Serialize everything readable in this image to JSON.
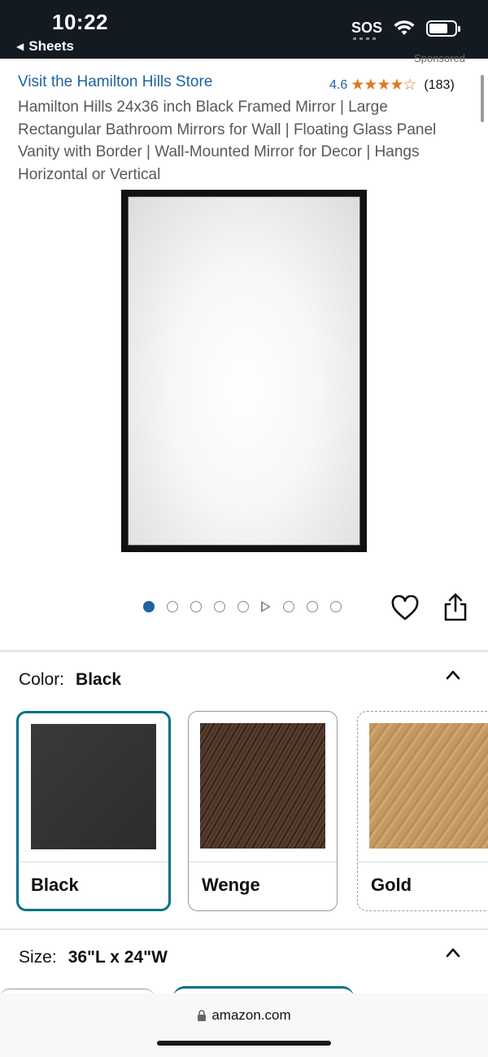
{
  "status_bar": {
    "time": "10:22",
    "back_label": "Sheets",
    "sos": "SOS"
  },
  "header": {
    "sponsored": "Sponsored",
    "store_link": "Visit the Hamilton Hills Store",
    "rating_value": "4.6",
    "rating_stars": "★★★★☆",
    "rating_count": "(183)"
  },
  "product": {
    "title": "Hamilton Hills 24x36 inch Black Framed Mirror | Large Rectangular Bathroom Mirrors for Wall | Floating Glass Panel Vanity with Border | Wall-Mounted Mirror for Decor | Hangs Horizontal or Vertical"
  },
  "carousel": {
    "active_index": 1,
    "total_items": 9,
    "video_item_index": 6
  },
  "color": {
    "label": "Color:",
    "selected": "Black",
    "options": [
      {
        "name": "Black",
        "swatch_color": "#333333"
      },
      {
        "name": "Wenge",
        "swatch_color": "#4a3326"
      },
      {
        "name": "Gold",
        "swatch_color": "#c49a63"
      }
    ]
  },
  "size": {
    "label": "Size:",
    "selected": "36\"L x 24\"W"
  },
  "browser": {
    "url": "amazon.com"
  },
  "colors": {
    "link": "#2162a1",
    "star": "#de7921",
    "selected_border": "#007185",
    "status_bar_bg": "#131a22"
  },
  "icons": [
    "wifi-icon",
    "battery-icon",
    "heart-icon",
    "share-icon",
    "chevron-up-icon",
    "lock-icon"
  ]
}
